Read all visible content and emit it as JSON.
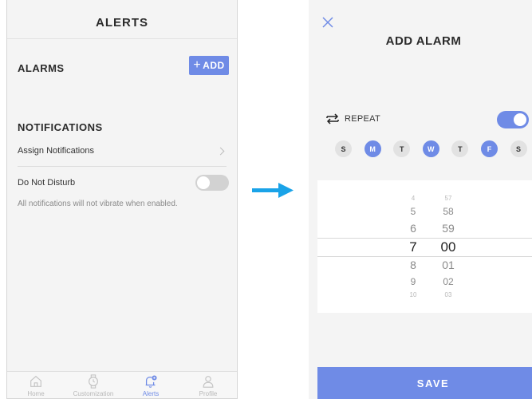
{
  "alerts_screen": {
    "title": "ALERTS",
    "alarms_heading": "ALARMS",
    "add_button": {
      "icon": "plus-icon",
      "label": "ADD"
    },
    "notifications_heading": "NOTIFICATIONS",
    "assign_notifications_label": "Assign Notifications",
    "do_not_disturb_label": "Do Not Disturb",
    "do_not_disturb_enabled": false,
    "do_not_disturb_description": "All notifications will not vibrate when enabled.",
    "tabs": [
      {
        "label": "Home",
        "icon": "home-icon",
        "active": false
      },
      {
        "label": "Customization",
        "icon": "watch-icon",
        "active": false
      },
      {
        "label": "Alerts",
        "icon": "bell-gear-icon",
        "active": true
      },
      {
        "label": "Profile",
        "icon": "user-icon",
        "active": false
      }
    ]
  },
  "add_alarm_screen": {
    "close_icon": "close-icon",
    "title": "ADD ALARM",
    "repeat_label": "REPEAT",
    "repeat_enabled": true,
    "days": [
      {
        "label": "S",
        "selected": false
      },
      {
        "label": "M",
        "selected": true
      },
      {
        "label": "T",
        "selected": false
      },
      {
        "label": "W",
        "selected": true
      },
      {
        "label": "T",
        "selected": false
      },
      {
        "label": "F",
        "selected": true
      },
      {
        "label": "S",
        "selected": false
      }
    ],
    "picker": {
      "hours": [
        "4",
        "5",
        "6",
        "7",
        "8",
        "9",
        "10"
      ],
      "minutes": [
        "57",
        "58",
        "59",
        "00",
        "01",
        "02",
        "03"
      ],
      "selected_hour": "7",
      "selected_minute": "00"
    },
    "save_label": "SAVE"
  },
  "colors": {
    "accent": "#6f8be6",
    "arrow": "#1aa3e8",
    "background": "#f4f4f4"
  }
}
